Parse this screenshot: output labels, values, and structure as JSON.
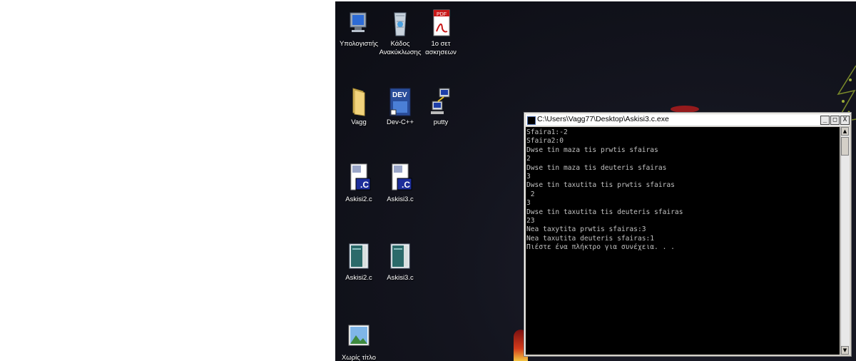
{
  "desktop": {
    "icons": [
      {
        "label": "Υπολογιστής",
        "icon": "computer-icon"
      },
      {
        "label": "Κάδος\nΑνακύκλωσης",
        "icon": "recycle-bin-icon"
      },
      {
        "label": "1ο σετ\nασκησεων",
        "icon": "pdf-icon"
      },
      {
        "label": "Vagg",
        "icon": "folder-icon"
      },
      {
        "label": "Dev-C++",
        "icon": "devcpp-icon"
      },
      {
        "label": "putty",
        "icon": "putty-icon"
      },
      {
        "label": "Askisi2.c",
        "icon": "c-source-icon"
      },
      {
        "label": "Askisi3.c",
        "icon": "c-source-icon"
      },
      {
        "label": "Askisi2.c",
        "icon": "c-file-icon"
      },
      {
        "label": "Askisi3.c",
        "icon": "c-file-icon"
      },
      {
        "label": "Χωρίς τίτλο",
        "icon": "image-icon"
      }
    ]
  },
  "console": {
    "title": "C:\\Users\\Vagg77\\Desktop\\Askisi3.c.exe",
    "buttons": {
      "minimize": "_",
      "maximize": "□",
      "close": "X"
    },
    "output": "Sfaira1:-2\nSfaira2:0\nDwse tin maza tis prwtis sfairas\n2\nDwse tin maza tis deuteris sfairas\n3\nDwse tin taxutita tis prwtis sfairas\n 2\n3\nDwse tin taxutita tis deuteris sfairas\n23\nNea taxytita prwtis sfairas:3\nNea taxutita deuteris sfairas:1\nΠιέστε ένα πλήκτρο για συνέχεια. . ."
  },
  "colors": {
    "console_bg": "#000000",
    "console_text": "#c0c0c0",
    "desktop_bg": "#14151f"
  }
}
